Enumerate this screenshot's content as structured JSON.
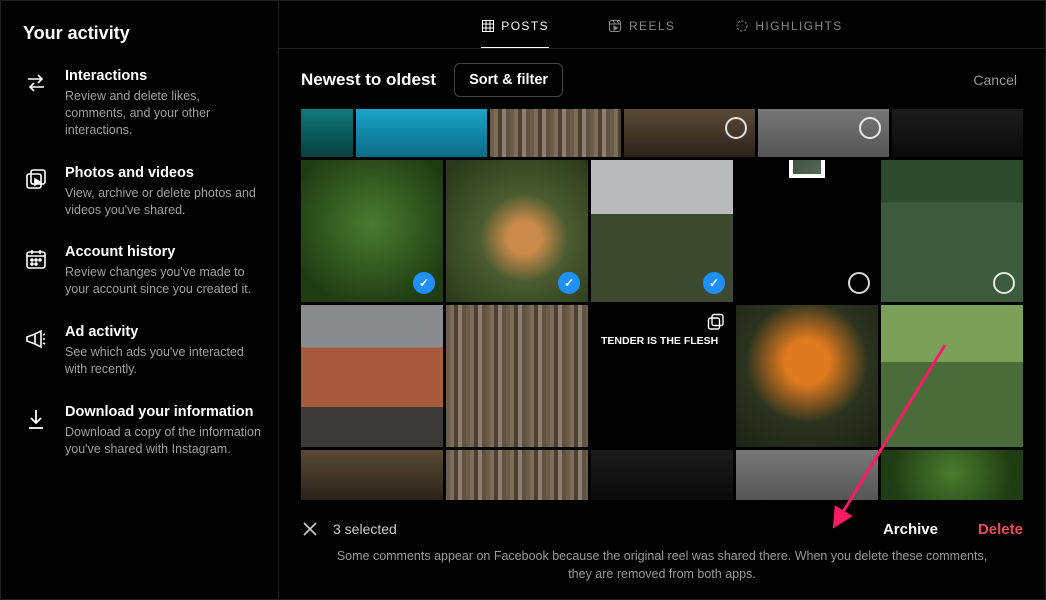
{
  "sidebar": {
    "heading": "Your activity",
    "items": [
      {
        "title": "Interactions",
        "desc": "Review and delete likes, comments, and your other interactions."
      },
      {
        "title": "Photos and videos",
        "desc": "View, archive or delete photos and videos you've shared."
      },
      {
        "title": "Account history",
        "desc": "Review changes you've made to your account since you created it."
      },
      {
        "title": "Ad activity",
        "desc": "See which ads you've interacted with recently."
      },
      {
        "title": "Download your information",
        "desc": "Download a copy of the information you've shared with Instagram."
      }
    ]
  },
  "tabs": {
    "posts": "POSTS",
    "reels": "REELS",
    "highlights": "HIGHLIGHTS",
    "active": "posts"
  },
  "toolbar": {
    "sort_label": "Newest to oldest",
    "sort_button": "Sort & filter",
    "cancel": "Cancel"
  },
  "grid": {
    "rows": [
      [
        {
          "kind": "teal",
          "marker": null
        },
        {
          "kind": "sea",
          "marker": null
        },
        {
          "kind": "pixelated",
          "marker": null
        },
        {
          "kind": "brown",
          "marker": "ring-top"
        },
        {
          "kind": "grey",
          "marker": "ring-top"
        },
        {
          "kind": "dark",
          "marker": null
        }
      ],
      [
        {
          "kind": "green",
          "marker": "selected"
        },
        {
          "kind": "mush",
          "marker": "selected"
        },
        {
          "kind": "tree",
          "marker": "selected"
        },
        {
          "kind": "white",
          "marker": "ring"
        },
        {
          "kind": "gazebo",
          "marker": "ring"
        }
      ],
      [
        {
          "kind": "castle",
          "marker": null
        },
        {
          "kind": "pixelated",
          "marker": null
        },
        {
          "kind": "book",
          "marker": null,
          "multi": true,
          "text": "TENDER IS THE FLESH"
        },
        {
          "kind": "orange",
          "marker": null
        },
        {
          "kind": "bridge",
          "marker": null
        }
      ],
      [
        {
          "kind": "brown",
          "marker": null
        },
        {
          "kind": "pixelated",
          "marker": null
        },
        {
          "kind": "dark",
          "marker": null
        },
        {
          "kind": "grey",
          "marker": null
        },
        {
          "kind": "green",
          "marker": null
        }
      ]
    ]
  },
  "footer": {
    "selected_count": "3 selected",
    "archive": "Archive",
    "delete": "Delete",
    "note": "Some comments appear on Facebook because the original reel was shared there. When you delete these comments, they are removed from both apps."
  },
  "colors": {
    "accent_blue": "#1e90ff",
    "danger": "#ed4956"
  }
}
